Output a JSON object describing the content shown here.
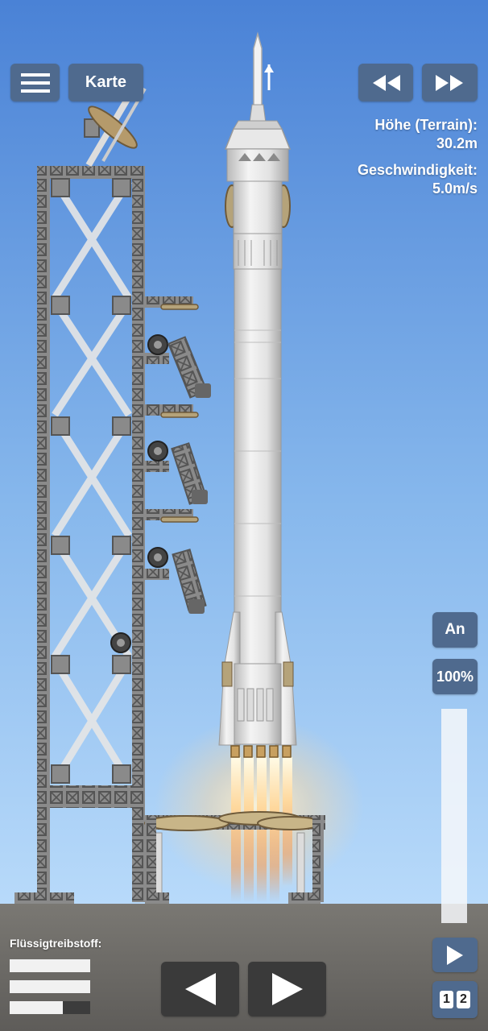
{
  "toolbar": {
    "menu_icon": "hamburger-menu-icon",
    "map_label": "Karte",
    "rewind_icon": "rewind-icon",
    "fast_forward_icon": "fast-forward-icon"
  },
  "telemetry": {
    "altitude_label": "Höhe (Terrain):",
    "altitude_value": "30.2m",
    "velocity_label": "Geschwindigkeit:",
    "velocity_value": "5.0m/s"
  },
  "controls": {
    "engine_label": "An",
    "throttle_label": "100%",
    "throttle_level": 1.0,
    "play_icon": "play-icon",
    "stage_numbers": [
      "1",
      "2"
    ],
    "rotate_left_icon": "arrow-left-icon",
    "rotate_right_icon": "arrow-right-icon"
  },
  "fuel": {
    "label": "Flüssigtreibstoff:",
    "levels": [
      1.0,
      1.0,
      0.66
    ]
  },
  "colors": {
    "sky_top": "#4a82d6",
    "sky_bottom": "#b5d8f7",
    "ground": "#6e6c68",
    "button": "#4f6a8e",
    "arrow_button": "#3a3a3a"
  }
}
